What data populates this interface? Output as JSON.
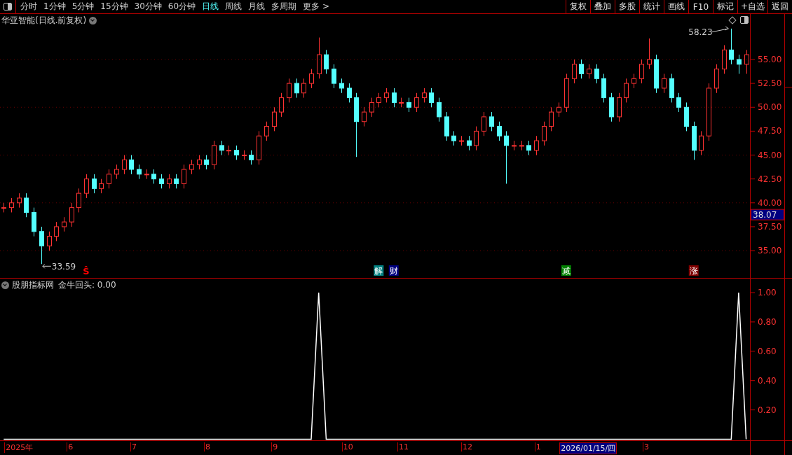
{
  "toolbar": {
    "periods": [
      {
        "label": "分时",
        "selected": false
      },
      {
        "label": "1分钟",
        "selected": false
      },
      {
        "label": "5分钟",
        "selected": false
      },
      {
        "label": "15分钟",
        "selected": false
      },
      {
        "label": "30分钟",
        "selected": false
      },
      {
        "label": "60分钟",
        "selected": false
      },
      {
        "label": "日线",
        "selected": true
      },
      {
        "label": "周线",
        "selected": false
      },
      {
        "label": "月线",
        "selected": false
      },
      {
        "label": "多周期",
        "selected": false
      },
      {
        "label": "更多 >",
        "selected": false
      }
    ],
    "buttons": [
      "复权",
      "叠加",
      "多股",
      "统计",
      "画线",
      "F10",
      "标记",
      "+自选",
      "返回"
    ]
  },
  "price_pane": {
    "title": "华亚智能(日线.前复权)",
    "current_price": "38.07",
    "chart_data": {
      "type": "candlestick",
      "ylim": [
        32.22,
        59.76
      ],
      "grid": true,
      "yticks": [
        {
          "value": 55,
          "label": "55.00"
        },
        {
          "value": 52.5,
          "label": "52.50"
        },
        {
          "value": 50,
          "label": "50.00"
        },
        {
          "value": 47.5,
          "label": "47.50"
        },
        {
          "value": 45,
          "label": "45.00"
        },
        {
          "value": 42.5,
          "label": "42.50"
        },
        {
          "value": 40,
          "label": "40.00"
        },
        {
          "value": 37.5,
          "label": "37.50"
        },
        {
          "value": 35,
          "label": "35.00"
        }
      ],
      "ohlc": [
        [
          39.5,
          40,
          39,
          39.5
        ],
        [
          39.5,
          40.5,
          39,
          40
        ],
        [
          40,
          41,
          39.5,
          40.5
        ],
        [
          40.5,
          41,
          38.5,
          39
        ],
        [
          39,
          39.5,
          36.5,
          37
        ],
        [
          37,
          37.5,
          33.59,
          35.5
        ],
        [
          35.5,
          37,
          35,
          36.5
        ],
        [
          36.5,
          38,
          36,
          37.5
        ],
        [
          37.5,
          38.5,
          37,
          38
        ],
        [
          38,
          40,
          37.5,
          39.5
        ],
        [
          39.5,
          41.5,
          39,
          41
        ],
        [
          41,
          43,
          40.5,
          42.5
        ],
        [
          42.5,
          43,
          41,
          41.5
        ],
        [
          41.5,
          42.5,
          41,
          42
        ],
        [
          42,
          43.5,
          41.5,
          43
        ],
        [
          43,
          44,
          42.5,
          43.5
        ],
        [
          43.5,
          45,
          43,
          44.5
        ],
        [
          44.5,
          45,
          43,
          43.5
        ],
        [
          43.5,
          44,
          42.5,
          43
        ],
        [
          43,
          43.5,
          42.5,
          43
        ],
        [
          43,
          43.5,
          42,
          42.5
        ],
        [
          42.5,
          43,
          41.5,
          42
        ],
        [
          42,
          43,
          41.5,
          42.5
        ],
        [
          42.5,
          43,
          41.5,
          42
        ],
        [
          42,
          44,
          41.5,
          43.5
        ],
        [
          43.5,
          44.5,
          43,
          44
        ],
        [
          44,
          45,
          43.5,
          44.5
        ],
        [
          44.5,
          45,
          43.5,
          44
        ],
        [
          44,
          46.5,
          43.5,
          46
        ],
        [
          46,
          46.5,
          45,
          45.5
        ],
        [
          45.5,
          46,
          45,
          45.5
        ],
        [
          45.5,
          46,
          44.5,
          45
        ],
        [
          45,
          45.5,
          44.5,
          45
        ],
        [
          45,
          45.5,
          44,
          44.5
        ],
        [
          44.5,
          47.5,
          44,
          47
        ],
        [
          47,
          48.5,
          46.5,
          48
        ],
        [
          48,
          50,
          47.5,
          49.5
        ],
        [
          49.5,
          51.5,
          49,
          51
        ],
        [
          51,
          53,
          50.5,
          52.5
        ],
        [
          52.5,
          53,
          51,
          51.5
        ],
        [
          51.5,
          53,
          51,
          52.5
        ],
        [
          52.5,
          54,
          52,
          53.5
        ],
        [
          53.5,
          57.3,
          53,
          55.5
        ],
        [
          55.5,
          56,
          53.5,
          54
        ],
        [
          54,
          54.5,
          52,
          52.5
        ],
        [
          52.5,
          53,
          51.5,
          52
        ],
        [
          52,
          52.5,
          50.5,
          51
        ],
        [
          51,
          51.5,
          44.8,
          48.5
        ],
        [
          48.5,
          50,
          48,
          49.5
        ],
        [
          49.5,
          51,
          49,
          50.5
        ],
        [
          50.5,
          51.5,
          50,
          51
        ],
        [
          51,
          52,
          50.5,
          51.5
        ],
        [
          51.5,
          52,
          50,
          50.5
        ],
        [
          50.5,
          51,
          50,
          50.5
        ],
        [
          50.5,
          51,
          49.5,
          50
        ],
        [
          50,
          51.5,
          49.5,
          51
        ],
        [
          51,
          52,
          50.5,
          51.5
        ],
        [
          51.5,
          52,
          50,
          50.5
        ],
        [
          50.5,
          51,
          48.5,
          49
        ],
        [
          49,
          49.5,
          46.5,
          47
        ],
        [
          47,
          47.5,
          46,
          46.5
        ],
        [
          46.5,
          47,
          46,
          46.5
        ],
        [
          46.5,
          47,
          45.5,
          46
        ],
        [
          46,
          48,
          45.5,
          47.5
        ],
        [
          47.5,
          49.5,
          47,
          49
        ],
        [
          49,
          49.5,
          47.5,
          48
        ],
        [
          48,
          48.5,
          46.5,
          47
        ],
        [
          47,
          47.5,
          42,
          46
        ],
        [
          46,
          46.5,
          45.5,
          46
        ],
        [
          46,
          46.5,
          45.5,
          46
        ],
        [
          46,
          46.5,
          45,
          45.5
        ],
        [
          45.5,
          47,
          45,
          46.5
        ],
        [
          46.5,
          48.5,
          46,
          48
        ],
        [
          48,
          50,
          47.5,
          49.5
        ],
        [
          49.5,
          50.5,
          49,
          50
        ],
        [
          50,
          53.5,
          49.5,
          53
        ],
        [
          53,
          55,
          52.5,
          54.5
        ],
        [
          54.5,
          55,
          53,
          53.5
        ],
        [
          53.5,
          54.5,
          53,
          54
        ],
        [
          54,
          54.5,
          52.5,
          53
        ],
        [
          53,
          53.5,
          50.5,
          51
        ],
        [
          51,
          51.5,
          48.5,
          49
        ],
        [
          49,
          51.5,
          48.5,
          51
        ],
        [
          51,
          53,
          50.5,
          52.5
        ],
        [
          52.5,
          53.5,
          52,
          53
        ],
        [
          53,
          55,
          52.5,
          54.5
        ],
        [
          54.5,
          57.2,
          54,
          55
        ],
        [
          55,
          55.5,
          51.5,
          52
        ],
        [
          52,
          53.5,
          51.5,
          53
        ],
        [
          53,
          53.5,
          50.5,
          51
        ],
        [
          51,
          51.5,
          49.5,
          50
        ],
        [
          50,
          50.5,
          47.5,
          48
        ],
        [
          48,
          48.5,
          44.5,
          45.5
        ],
        [
          45.5,
          47.5,
          45,
          47
        ],
        [
          47,
          52.5,
          46.5,
          52
        ],
        [
          52,
          54.5,
          51.5,
          54
        ],
        [
          54,
          56.5,
          53.5,
          56
        ],
        [
          56,
          58.23,
          54.5,
          55
        ],
        [
          55,
          55.5,
          53.5,
          54.5
        ],
        [
          54.5,
          56,
          53.5,
          55.5
        ]
      ],
      "annotations": [
        "33.59",
        "58.23"
      ]
    },
    "signals": [
      {
        "kind": "arrow",
        "label": "Ŝ",
        "color": "#ff0000"
      },
      {
        "kind": "tag",
        "label": "解",
        "color": "#008080"
      },
      {
        "kind": "tag",
        "label": "财",
        "color": "#000080"
      },
      {
        "kind": "tag",
        "label": "减",
        "color": "#008000"
      },
      {
        "kind": "tag",
        "label": "涨",
        "color": "#800000"
      }
    ]
  },
  "indicator_pane": {
    "source": "股朋指标网",
    "reading": "金牛回头: 0.00",
    "chart_data": {
      "type": "line",
      "ylim": [
        -0.0072,
        1.0955
      ],
      "yticks": [
        {
          "value": 1,
          "label": "1.00"
        },
        {
          "value": 0.8,
          "label": "0.80"
        },
        {
          "value": 0.6,
          "label": "0.60"
        },
        {
          "value": 0.4,
          "label": "0.40"
        },
        {
          "value": 0.2,
          "label": "0.20"
        }
      ],
      "series": [
        {
          "color": "#ffffff",
          "values": [
            0,
            0,
            0,
            0,
            0,
            0,
            0,
            0,
            0,
            0,
            0,
            0,
            0,
            0,
            0,
            0,
            0,
            0,
            0,
            0,
            0,
            0,
            0,
            0,
            0,
            0,
            0,
            0,
            0,
            0,
            0,
            0,
            0,
            0,
            0,
            0,
            0,
            0,
            0,
            0,
            0,
            0,
            1,
            0,
            0,
            0,
            0,
            0,
            0,
            0,
            0,
            0,
            0,
            0,
            0,
            0,
            0,
            0,
            0,
            0,
            0,
            0,
            0,
            0,
            0,
            0,
            0,
            0,
            0,
            0,
            0,
            0,
            0,
            0,
            0,
            0,
            0,
            0,
            0,
            0,
            0,
            0,
            0,
            0,
            0,
            0,
            0,
            0,
            0,
            0,
            0,
            0,
            0,
            0,
            0,
            0,
            0,
            0,
            1,
            0
          ]
        }
      ]
    }
  },
  "time_axis": {
    "ticks": [
      "2025年",
      "6",
      "7",
      "8",
      "9",
      "10",
      "11",
      "12",
      "1",
      "3"
    ],
    "cursor": "2026/01/15/四"
  }
}
